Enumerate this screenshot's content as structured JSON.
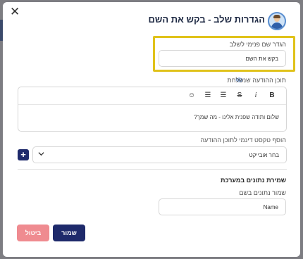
{
  "dialog": {
    "title": "הגדרות שלב - בקש את השם",
    "close_glyph": "✕"
  },
  "step_name": {
    "label": "הגדר שם פנימי לשלב",
    "value": "בקש את השם"
  },
  "message": {
    "label": "תוכן ההודעה שנשלחת",
    "text": "שלום ותודה שפנית אלינו - מה שמך?"
  },
  "toolbar": {
    "bold": "B",
    "italic": "i",
    "strike": "S",
    "align_left": "☰",
    "align_right": "☰",
    "emoji": "☺"
  },
  "dynamic_text": {
    "label": "הוסף טקסט דינמי לתוכן ההודעה",
    "select_value": "בחר אובייקט",
    "add_glyph": "+"
  },
  "save_data": {
    "section_title": "שמירת נתונים במערכת",
    "field_label": "שמור נתונים בשם",
    "field_value": "Name"
  },
  "buttons": {
    "save": "שמור",
    "cancel": "ביטול"
  },
  "colors": {
    "primary": "#1e2a6b",
    "cancel": "#ef8b90",
    "highlight": "#e0c21a"
  }
}
